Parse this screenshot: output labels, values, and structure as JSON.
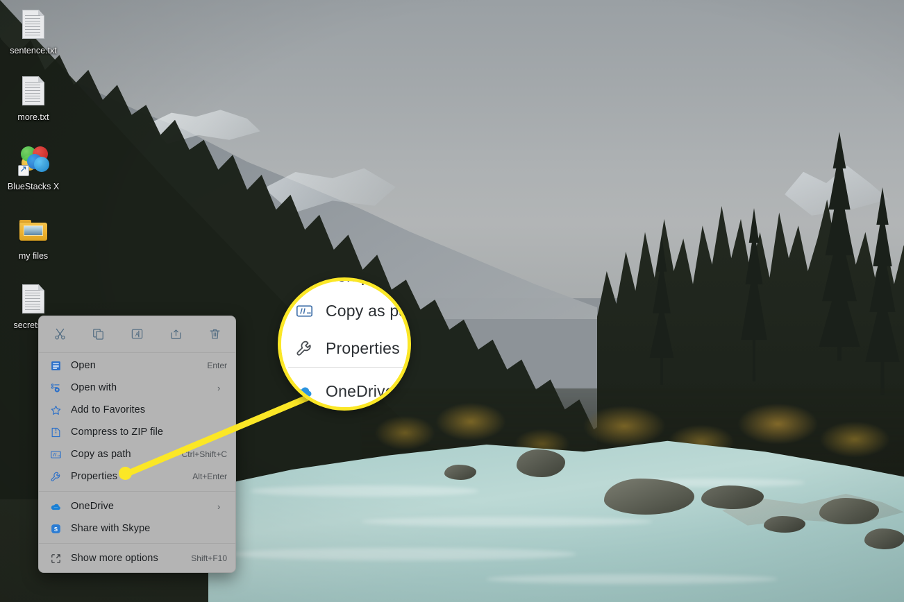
{
  "desktop": {
    "icons": [
      {
        "label": "sentence.txt",
        "type": "text-file"
      },
      {
        "label": "more.txt",
        "type": "text-file"
      },
      {
        "label": "BlueStacks X",
        "type": "app-shortcut"
      },
      {
        "label": "my files",
        "type": "folder"
      },
      {
        "label": "secrets.txt",
        "type": "text-file"
      }
    ],
    "wallpaper_description": "Glacial turquoise river with evergreen forest and snowy mountain under overcast sky"
  },
  "context_menu": {
    "toolbar": [
      {
        "name": "cut",
        "tooltip": "Cut"
      },
      {
        "name": "copy",
        "tooltip": "Copy"
      },
      {
        "name": "rename",
        "tooltip": "Rename"
      },
      {
        "name": "share",
        "tooltip": "Share"
      },
      {
        "name": "delete",
        "tooltip": "Delete"
      }
    ],
    "groups": [
      {
        "items": [
          {
            "label": "Open",
            "accel": "Enter",
            "icon": "open-icon",
            "submenu": false
          },
          {
            "label": "Open with",
            "accel": "",
            "icon": "open-with-icon",
            "submenu": true
          },
          {
            "label": "Add to Favorites",
            "accel": "",
            "icon": "star-icon",
            "submenu": false
          },
          {
            "label": "Compress to ZIP file",
            "accel": "",
            "icon": "zip-icon",
            "submenu": false
          },
          {
            "label": "Copy as path",
            "accel": "Ctrl+Shift+C",
            "icon": "copy-as-path-icon",
            "submenu": false
          },
          {
            "label": "Properties",
            "accel": "Alt+Enter",
            "icon": "wrench-icon",
            "submenu": false
          }
        ]
      },
      {
        "items": [
          {
            "label": "OneDrive",
            "accel": "",
            "icon": "onedrive-icon",
            "submenu": true
          },
          {
            "label": "Share with Skype",
            "accel": "",
            "icon": "skype-icon",
            "submenu": false
          }
        ]
      },
      {
        "items": [
          {
            "label": "Show more options",
            "accel": "Shift+F10",
            "icon": "show-more-icon",
            "submenu": false
          }
        ]
      }
    ]
  },
  "magnifier": {
    "accent_color": "#fbe726",
    "clipped_top_label": "Comp",
    "rows": [
      {
        "label": "Copy as path",
        "icon": "copy-as-path-icon"
      },
      {
        "label": "Properties",
        "icon": "wrench-icon"
      },
      {
        "label": "OneDrive",
        "icon": "onedrive-icon"
      }
    ]
  }
}
